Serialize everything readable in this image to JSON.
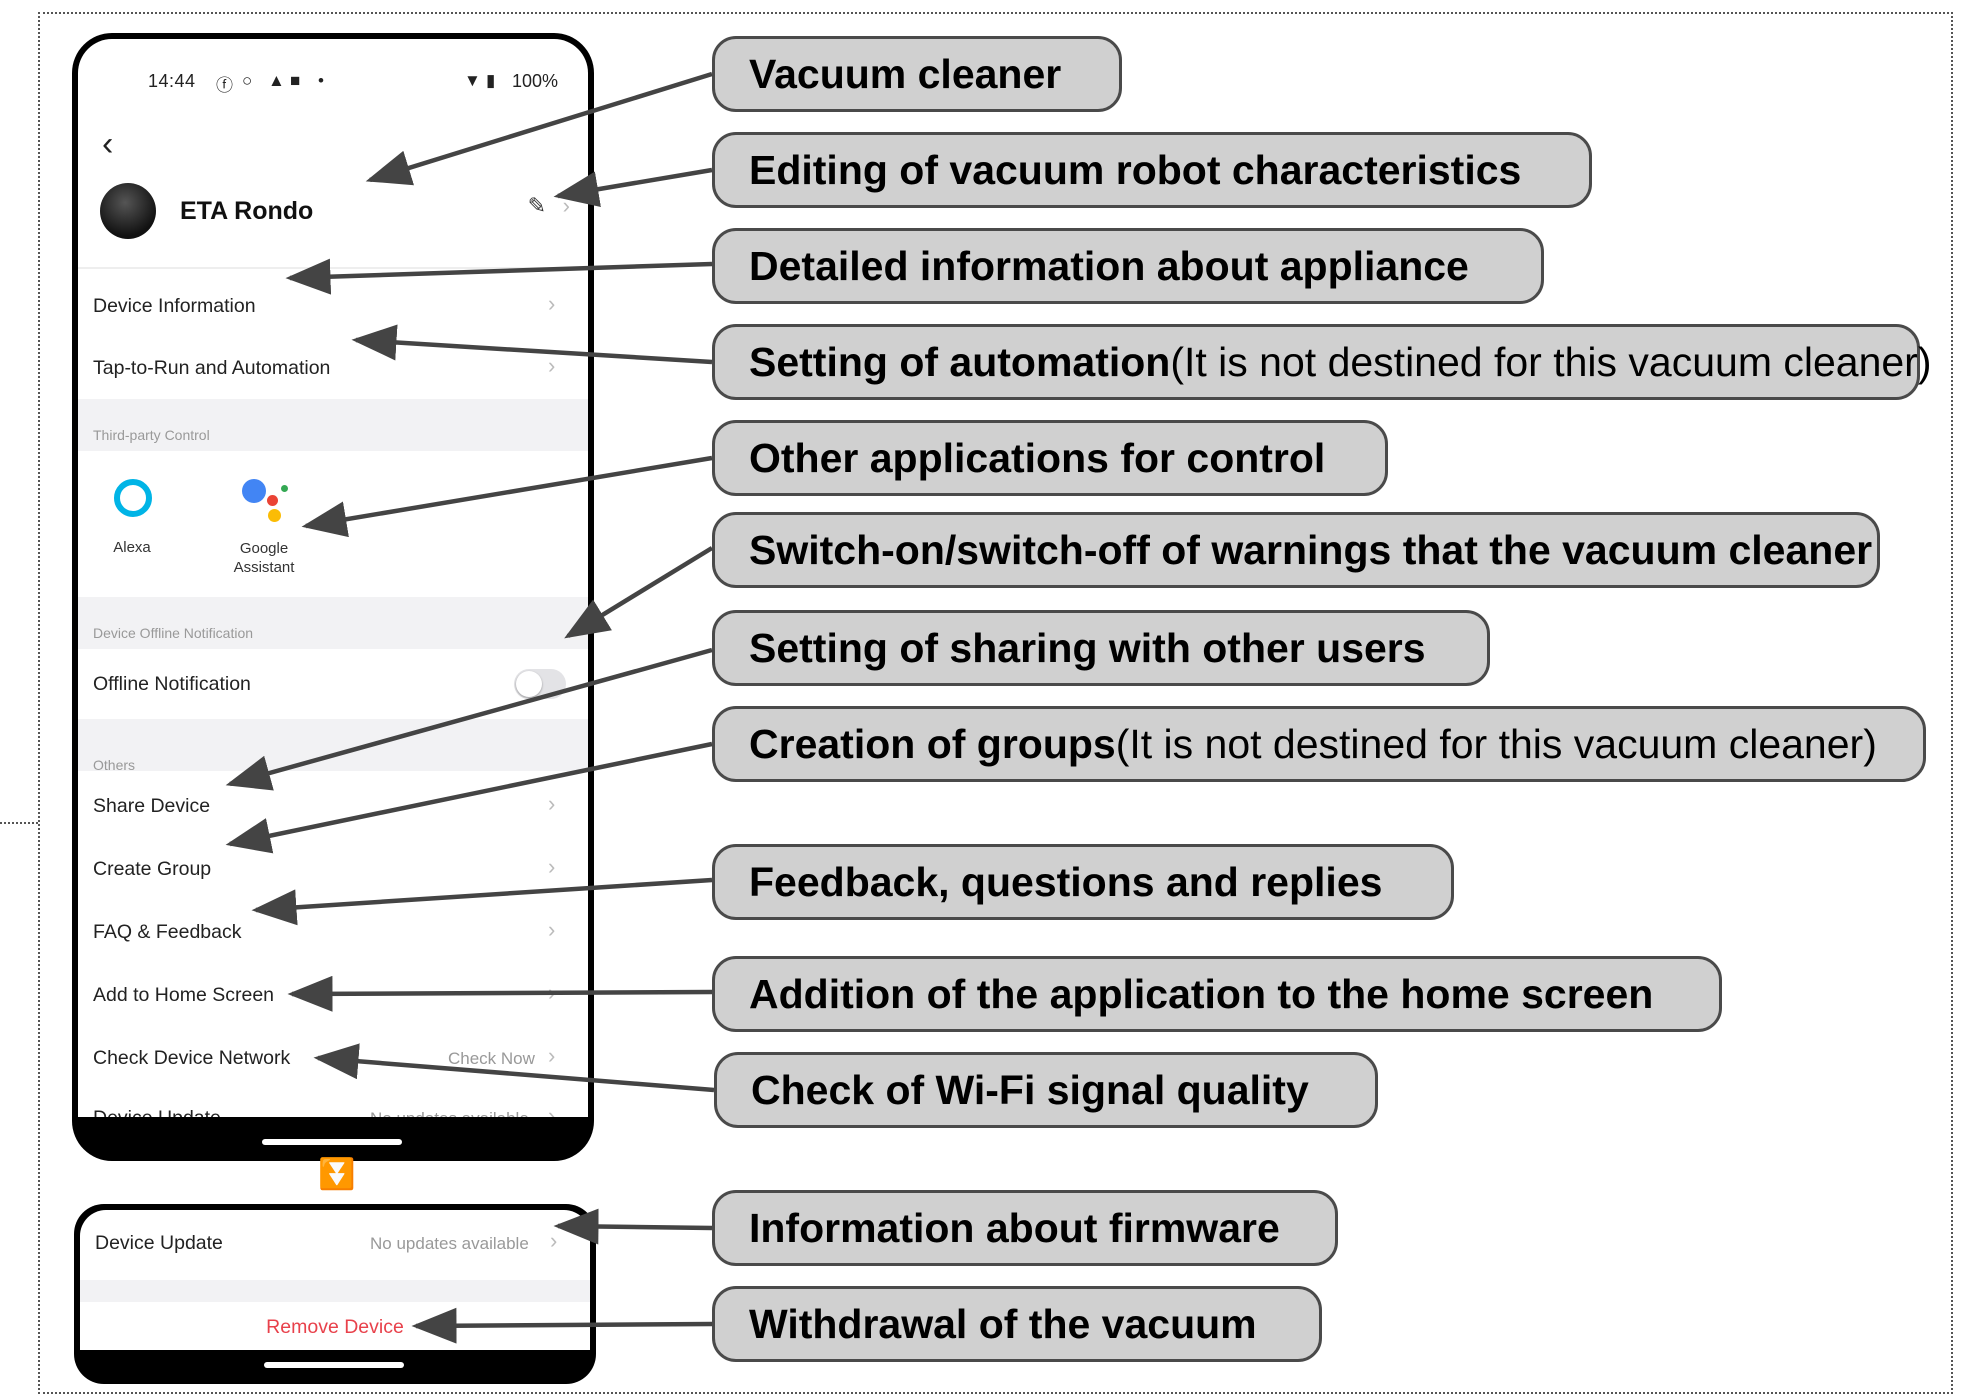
{
  "status_bar": {
    "time": "14:44",
    "battery": "100%"
  },
  "device": {
    "name": "ETA Rondo"
  },
  "menu": {
    "device_information": "Device Information",
    "tap_to_run": "Tap-to-Run and Automation",
    "third_party_section": "Third-party Control",
    "alexa": "Alexa",
    "google_line1": "Google",
    "google_line2": "Assistant",
    "offline_section": "Device Offline Notification",
    "offline_notification": "Offline Notification",
    "offline_notification_enabled": false,
    "others_section": "Others",
    "share_device": "Share Device",
    "create_group": "Create Group",
    "faq": "FAQ & Feedback",
    "add_home": "Add to Home Screen",
    "check_network": "Check Device Network",
    "check_now": "Check Now",
    "device_update": "Device Update",
    "no_updates": "No updates available",
    "remove_device": "Remove Device"
  },
  "callouts": [
    {
      "bold": "Vacuum cleaner",
      "normal": ""
    },
    {
      "bold": "Editing of vacuum robot characteristics",
      "normal": ""
    },
    {
      "bold": "Detailed information about appliance",
      "normal": ""
    },
    {
      "bold": "Setting of automation",
      "normal": " (It is not destined for this vacuum cleaner)"
    },
    {
      "bold": "Other applications for control",
      "normal": ""
    },
    {
      "bold": "Switch-on/switch-off of warnings that the vacuum cleaner",
      "normal": ""
    },
    {
      "bold": "Setting of sharing with other users",
      "normal": ""
    },
    {
      "bold": "Creation of groups",
      "normal": " (It is not destined for this vacuum cleaner)"
    },
    {
      "bold": "Feedback, questions and replies",
      "normal": ""
    },
    {
      "bold": "Addition of the application to the home screen",
      "normal": ""
    },
    {
      "bold": "Check of Wi-Fi signal quality",
      "normal": ""
    },
    {
      "bold": "Information about firmware",
      "normal": ""
    },
    {
      "bold": "Withdrawal of the vacuum",
      "normal": ""
    }
  ]
}
